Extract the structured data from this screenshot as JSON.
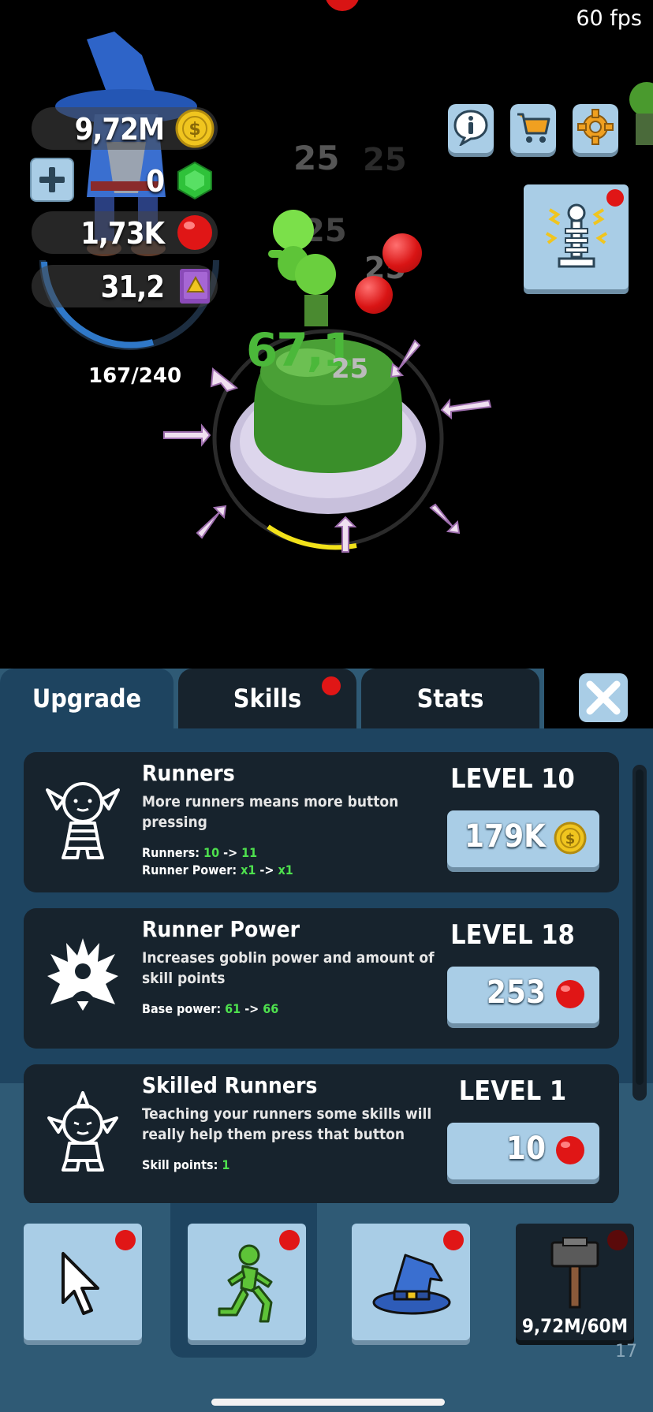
{
  "status": {
    "fps": "60 fps"
  },
  "resources": {
    "coins": "9,72M",
    "gems": "0",
    "orbs": "1,73K",
    "books": "31,2",
    "xp": "167/240"
  },
  "game": {
    "floating_numbers": [
      "25",
      "25",
      "25",
      "25",
      "25",
      "25"
    ],
    "big_number": "67,1",
    "colors": {
      "button_green": "#3a8f2a",
      "goblin_green": "#7be04a",
      "orb_red": "#e01616",
      "ring": "#c8c0dc"
    }
  },
  "top_buttons": [
    {
      "name": "info-icon"
    },
    {
      "name": "cart-icon"
    },
    {
      "name": "gear-icon"
    }
  ],
  "tabs": [
    {
      "label": "Upgrade",
      "active": true
    },
    {
      "label": "Skills",
      "active": false,
      "notification": true
    },
    {
      "label": "Stats",
      "active": false
    }
  ],
  "upgrades": [
    {
      "title": "Runners",
      "description": "More runners means more button pressing",
      "stats": [
        {
          "label": "Runners: ",
          "from": "10",
          "arrow": " -> ",
          "to": "11"
        },
        {
          "label": "Runner Power: ",
          "from": "x1",
          "arrow": " -> ",
          "to": "x1"
        }
      ],
      "level": "LEVEL 10",
      "cost": "179K",
      "currency_icon": "coin-icon"
    },
    {
      "title": "Runner Power",
      "description": "Increases goblin power and amount of skill points",
      "stats": [
        {
          "label": "Base power: ",
          "from": "61",
          "arrow": " -> ",
          "to": "66"
        }
      ],
      "level": "LEVEL 18",
      "cost": "253",
      "currency_icon": "orb-icon"
    },
    {
      "title": "Skilled Runners",
      "description": "Teaching your runners some skills will really help them press that button",
      "stats": [
        {
          "label": "Skill points: ",
          "from": "1"
        }
      ],
      "level": "LEVEL 1",
      "cost": "10",
      "currency_icon": "orb-icon"
    }
  ],
  "bottom_nav": {
    "items": [
      {
        "name": "cursor-icon"
      },
      {
        "name": "runner-icon"
      },
      {
        "name": "wizard-hat-icon"
      },
      {
        "name": "hammer-icon",
        "label": "9,72M/60M"
      }
    ],
    "page": "17"
  }
}
